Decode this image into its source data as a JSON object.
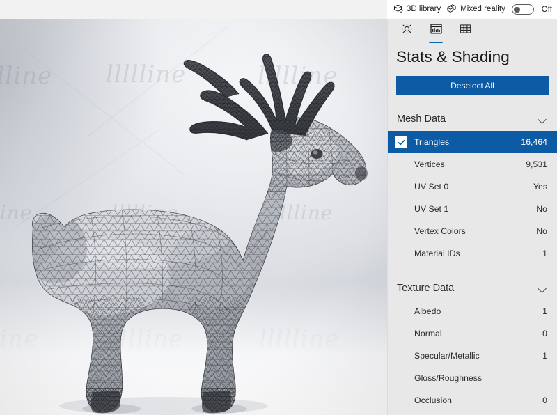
{
  "topbar": {
    "library_label": "3D library",
    "library_icon": "cube-3d-icon",
    "mixed_reality_label": "Mixed reality",
    "mixed_reality_icon": "mixed-reality-icon",
    "mixed_reality_state": "Off"
  },
  "tabs": [
    {
      "id": "lighting",
      "icon": "sun-brightness-icon",
      "selected": false
    },
    {
      "id": "stats-shading",
      "icon": "stats-chart-icon",
      "selected": true
    },
    {
      "id": "grid",
      "icon": "grid-wireframe-icon",
      "selected": false
    }
  ],
  "panel": {
    "title": "Stats & Shading",
    "deselect_label": "Deselect All",
    "accent_color": "#0c5ba4",
    "background_color": "#e8e8e8"
  },
  "sections": [
    {
      "title": "Mesh Data",
      "expanded": true,
      "rows": [
        {
          "label": "Triangles",
          "value": "16,464",
          "selected": true,
          "checkbox": true
        },
        {
          "label": "Vertices",
          "value": "9,531",
          "selected": false,
          "checkbox": false
        },
        {
          "label": "UV Set 0",
          "value": "Yes",
          "selected": false,
          "checkbox": false
        },
        {
          "label": "UV Set 1",
          "value": "No",
          "selected": false,
          "checkbox": false
        },
        {
          "label": "Vertex Colors",
          "value": "No",
          "selected": false,
          "checkbox": false
        },
        {
          "label": "Material IDs",
          "value": "1",
          "selected": false,
          "checkbox": false
        }
      ]
    },
    {
      "title": "Texture Data",
      "expanded": true,
      "rows": [
        {
          "label": "Albedo",
          "value": "1",
          "selected": false,
          "checkbox": false
        },
        {
          "label": "Normal",
          "value": "0",
          "selected": false,
          "checkbox": false
        },
        {
          "label": "Specular/Metallic",
          "value": "1",
          "selected": false,
          "checkbox": false
        },
        {
          "label": "Gloss/Roughness",
          "value": "",
          "selected": false,
          "checkbox": false
        },
        {
          "label": "Occlusion",
          "value": "0",
          "selected": false,
          "checkbox": false
        }
      ]
    }
  ],
  "viewport": {
    "model_name": "deer-wireframe-model",
    "watermark_text": "llllline"
  }
}
